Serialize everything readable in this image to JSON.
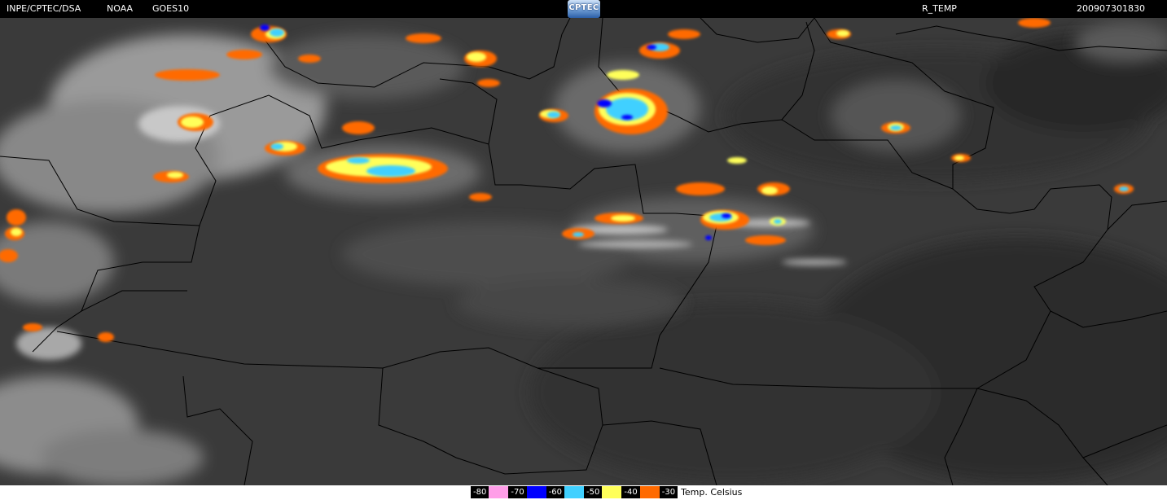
{
  "header": {
    "source": "INPE/CPTEC/DSA",
    "agency": "NOAA",
    "satellite": "GOES10",
    "logo_text": "CPTEC",
    "product": "R_TEMP",
    "timestamp": "200907301830"
  },
  "legend": {
    "bins": [
      {
        "label": "-80",
        "color": "#ff9ee8"
      },
      {
        "label": "-70",
        "color": "#0000ff"
      },
      {
        "label": "-60",
        "color": "#40d0ff"
      },
      {
        "label": "-50",
        "color": "#ffff5a"
      },
      {
        "label": "-40",
        "color": "#ff6a00"
      },
      {
        "label": "-30",
        "color": ""
      }
    ],
    "unit_label": "Temp. Celsius"
  },
  "colors": {
    "background": "#3a3a3a",
    "cloud": "#bdbdbd",
    "border_lines": "#000000"
  }
}
